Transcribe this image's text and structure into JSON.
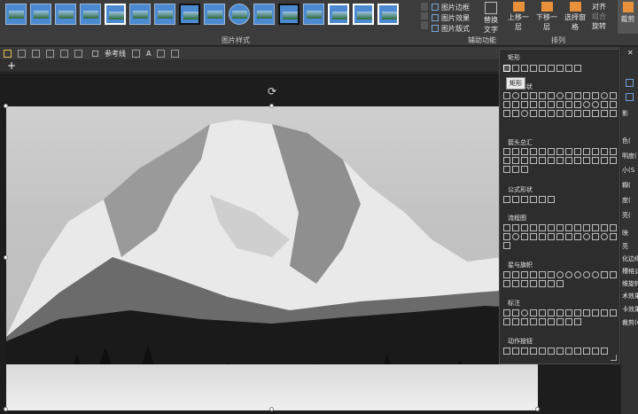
{
  "ribbon": {
    "picture_styles_label": "图片样式",
    "picture_border": "图片边框",
    "picture_effects": "图片效果",
    "picture_layout": "图片版式",
    "alt_text_line1": "替换",
    "alt_text_line2": "文字",
    "accessibility_label": "辅助功能",
    "arrange_label": "排列",
    "bring_forward": "上移一层",
    "send_backward": "下移一层",
    "selection_pane": "选择窗格",
    "align": "对齐",
    "group": "组合",
    "rotate": "旋转",
    "crop": "裁剪"
  },
  "toolbar": {
    "gridlines_label": "参考线",
    "font_size_label": "A"
  },
  "shapes_panel": {
    "recent_title": "矩形",
    "tooltip": "矩形",
    "basic_shapes_title": "基本形状",
    "arrows_title": "箭头总汇",
    "equation_title": "公式形状",
    "flowchart_title": "流程图",
    "stars_title": "星与旗帜",
    "callouts_title": "标注",
    "action_buttons_title": "动作按钮"
  },
  "task_pane": {
    "items": [
      "影",
      "色(",
      "明度(",
      "小(S",
      "糊(",
      "度(",
      "亮(",
      "映",
      "亮",
      "化边缘",
      "槽格式",
      "维旋转",
      "术效果",
      "卡效果",
      "裁剪(C"
    ]
  }
}
